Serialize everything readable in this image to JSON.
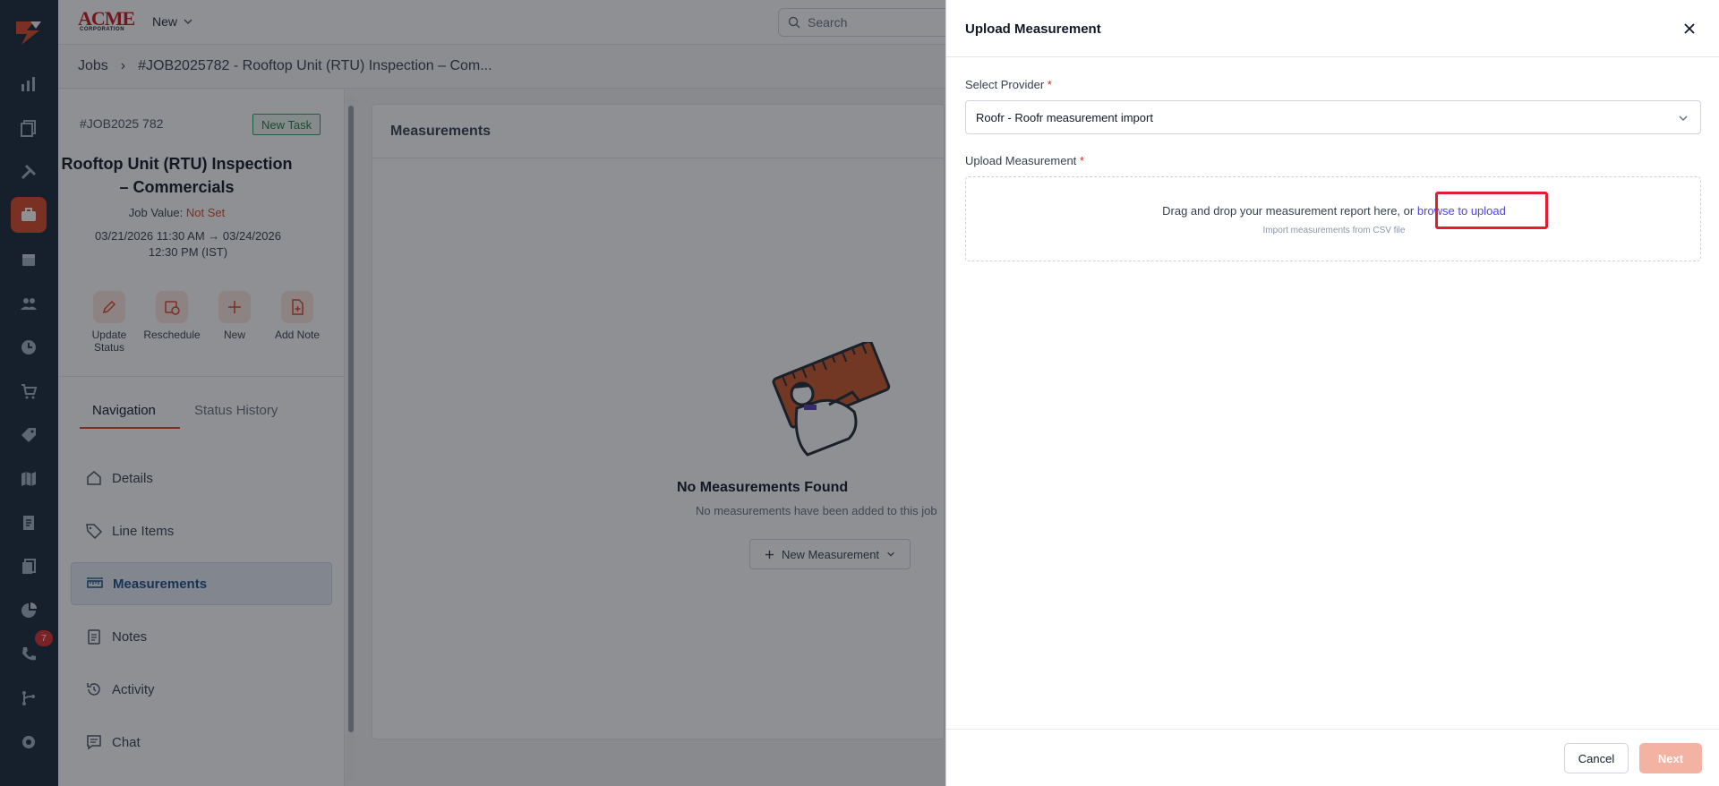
{
  "topbar": {
    "brand_text": "ACME",
    "brand_sub": "CORPORATION",
    "new_label": "New",
    "search_placeholder": "Search"
  },
  "breadcrumb": {
    "root": "Jobs",
    "separator": "›",
    "current": "#JOB2025782 - Rooftop Unit (RTU) Inspection – Com..."
  },
  "job": {
    "id": "#JOB2025 782",
    "status_badge": "New Task",
    "title": "Rooftop Unit (RTU) Inspection – Commercials",
    "value_label": "Job Value:",
    "value": "Not Set",
    "dates": "03/21/2026 11:30 AM → 03/24/2026 12:30 PM (IST)",
    "actions": [
      {
        "label": "Update Status",
        "icon": "pencil-icon"
      },
      {
        "label": "Reschedule",
        "icon": "calendar-clock-icon"
      },
      {
        "label": "New",
        "icon": "plus-icon"
      },
      {
        "label": "Add Note",
        "icon": "note-add-icon"
      }
    ],
    "tabs": [
      {
        "label": "Navigation",
        "active": true
      },
      {
        "label": "Status History",
        "active": false
      }
    ],
    "nav": [
      {
        "label": "Details",
        "icon": "home-icon"
      },
      {
        "label": "Line Items",
        "icon": "tag-icon"
      },
      {
        "label": "Measurements",
        "icon": "ruler-icon",
        "active": true
      },
      {
        "label": "Notes",
        "icon": "clipboard-icon"
      },
      {
        "label": "Activity",
        "icon": "history-icon"
      },
      {
        "label": "Chat",
        "icon": "chat-icon"
      }
    ]
  },
  "main": {
    "header": "Measurements",
    "empty_title": "No Measurements Found",
    "empty_sub": "No measurements have been added to this job",
    "new_button": "New Measurement"
  },
  "rail": {
    "badge_count": "7",
    "icons": [
      "logo-icon",
      "chart-icon",
      "documents-icon",
      "tools-icon",
      "briefcase-icon",
      "calendar-icon",
      "users-icon",
      "clock-icon",
      "cart-icon",
      "tag-icon",
      "map-icon",
      "invoice-icon",
      "files-icon",
      "pie-chart-icon",
      "phone-icon",
      "workflow-icon",
      "settings-icon"
    ]
  },
  "drawer": {
    "title": "Upload Measurement",
    "provider_label": "Select Provider",
    "required_mark": "*",
    "provider_value": "Roofr - Roofr measurement import",
    "upload_label": "Upload Measurement",
    "drop_text": "Drag and drop your measurement report here, or",
    "browse_link": "browse to upload",
    "drop_sub": "Import measurements from CSV file",
    "cancel": "Cancel",
    "next": "Next"
  },
  "colors": {
    "accent": "#d9472b",
    "rail_bg": "#17283a",
    "link": "#4f46e5",
    "highlight": "#e11d2e",
    "next_disabled": "#f4b2a3"
  }
}
